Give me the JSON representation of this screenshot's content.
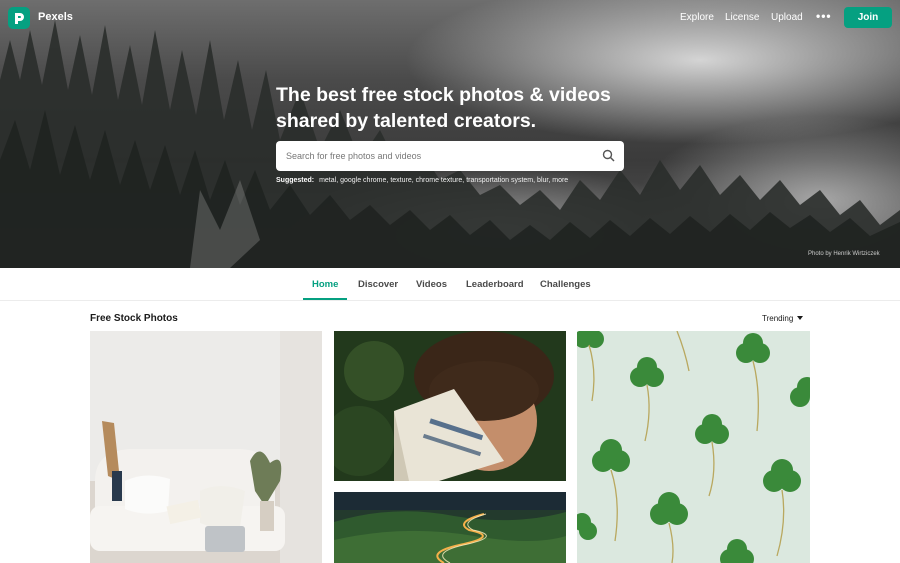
{
  "header": {
    "brand": "Pexels",
    "nav": [
      "Explore",
      "License",
      "Upload"
    ],
    "more_label": "•••",
    "join_label": "Join"
  },
  "hero": {
    "headline_line1": "The best free stock photos & videos",
    "headline_line2": "shared by talented creators.",
    "search_placeholder": "Search for free photos and videos",
    "suggested_label": "Suggested:",
    "suggested_items": [
      "metal,",
      "google chrome,",
      "texture,",
      "chrome texture,",
      "transportation system,",
      "blur,",
      "more"
    ],
    "credit": "Photo by Henrik Wirtziczek"
  },
  "tabs": [
    "Home",
    "Discover",
    "Videos",
    "Leaderboard",
    "Challenges"
  ],
  "content": {
    "section_title": "Free Stock Photos",
    "sort_label": "Trending"
  },
  "colors": {
    "accent": "#05a081"
  }
}
